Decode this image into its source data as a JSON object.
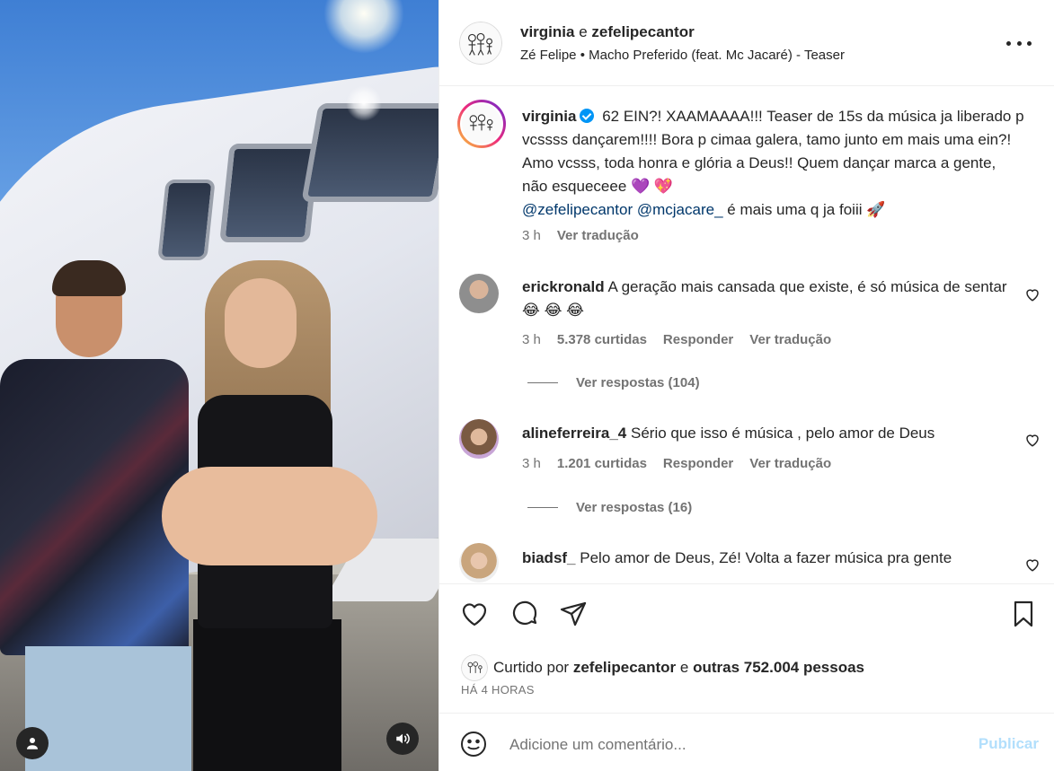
{
  "post": {
    "header": {
      "author": "virginia",
      "connector": "e",
      "coauthor": "zefelipecantor",
      "audio_artist": "Zé Felipe",
      "audio_sep": "•",
      "audio_title": "Macho Preferido (feat. Mc Jacaré) - Teaser",
      "more_icon": "more-horizontal-icon"
    },
    "caption": {
      "username": "virginia",
      "text_1": "62 EIN?! XAAMAAAA!!! Teaser de 15s da música ja liberado p vcssss dançarem!!!! Bora p cimaa galera, tamo junto em mais uma ein?! Amo vcsss, toda honra e glória a Deus!! Quem dançar marca a gente, não esqueceee 💜 💖",
      "mention_1": "@zefelipecantor",
      "mention_2": "@mcjacare_",
      "text_2": "é mais uma q ja foiii 🚀",
      "time": "3 h",
      "translate": "Ver tradução"
    },
    "comments": [
      {
        "username": "erickronald",
        "text": "A geração mais cansada que existe, é só música de sentar 😂 😂 😂",
        "time": "3 h",
        "likes": "5.378 curtidas",
        "reply": "Responder",
        "translate": "Ver tradução",
        "replies": "Ver respostas (104)"
      },
      {
        "username": "alineferreira_4",
        "text": "Sério que isso é música , pelo amor de Deus",
        "time": "3 h",
        "likes": "1.201 curtidas",
        "reply": "Responder",
        "translate": "Ver tradução",
        "replies": "Ver respostas (16)"
      },
      {
        "username": "biadsf_",
        "text": "Pelo amor de Deus, Zé! Volta a fazer música pra gente"
      }
    ],
    "liked_by": {
      "prefix": "Curtido por",
      "user": "zefelipecantor",
      "connector": "e",
      "others": "outras 752.004 pessoas"
    },
    "time_ago": "HÁ 4 HORAS",
    "add_comment": {
      "placeholder": "Adicione um comentário...",
      "publish": "Publicar"
    }
  },
  "icons": [
    "heart-icon",
    "comment-icon",
    "share-icon",
    "bookmark-icon",
    "emoji-icon",
    "user-tag-icon",
    "volume-icon",
    "verified-icon"
  ],
  "colors": {
    "link": "#00376b",
    "muted": "#737373",
    "verified": "#0095f6",
    "publish_disabled": "#b2dffc"
  }
}
